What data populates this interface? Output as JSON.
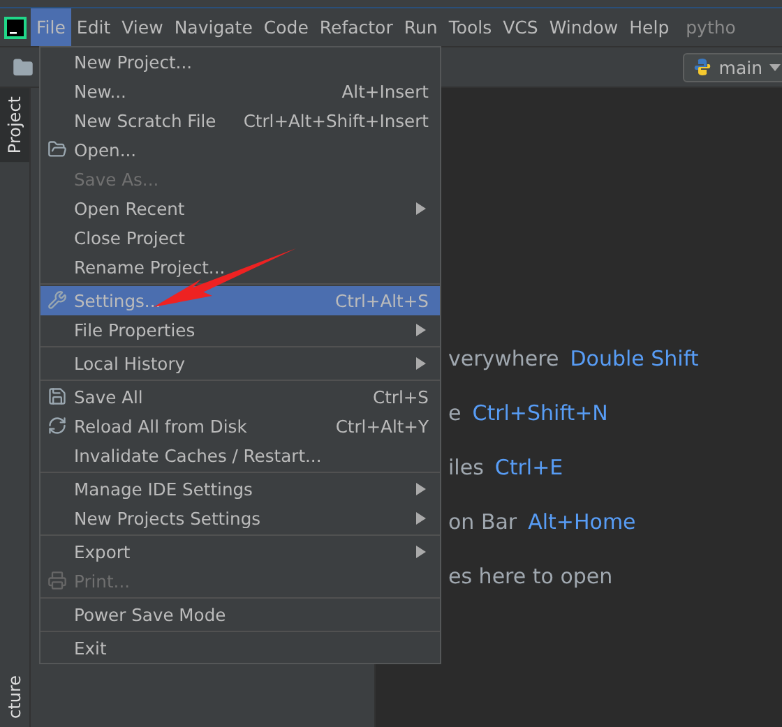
{
  "menu_bar": {
    "items": [
      {
        "label": "File",
        "selected": true
      },
      {
        "label": "Edit",
        "selected": false
      },
      {
        "label": "View",
        "selected": false
      },
      {
        "label": "Navigate",
        "selected": false
      },
      {
        "label": "Code",
        "selected": false
      },
      {
        "label": "Refactor",
        "selected": false
      },
      {
        "label": "Run",
        "selected": false
      },
      {
        "label": "Tools",
        "selected": false
      },
      {
        "label": "VCS",
        "selected": false
      },
      {
        "label": "Window",
        "selected": false
      },
      {
        "label": "Help",
        "selected": false
      }
    ],
    "project_title": "pytho"
  },
  "toolbar": {
    "run_config": "main"
  },
  "tool_strip": {
    "tabs": [
      {
        "label": "Project",
        "selected": true
      },
      {
        "label": "cture",
        "selected": false
      }
    ]
  },
  "editor_hints": [
    {
      "text": "verywhere",
      "shortcut": "Double Shift"
    },
    {
      "text": "e",
      "shortcut": "Ctrl+Shift+N"
    },
    {
      "text": "iles",
      "shortcut": "Ctrl+E"
    },
    {
      "text": "on Bar",
      "shortcut": "Alt+Home"
    },
    {
      "text": "es here to open"
    }
  ],
  "file_menu": {
    "groups": [
      [
        {
          "label": "New Project...",
          "disabled": false,
          "selected": false,
          "submenu": false
        },
        {
          "label": "New...",
          "shortcut": "Alt+Insert",
          "disabled": false,
          "selected": false,
          "submenu": false
        },
        {
          "label": "New Scratch File",
          "shortcut": "Ctrl+Alt+Shift+Insert",
          "disabled": false,
          "selected": false,
          "submenu": false
        },
        {
          "label": "Open...",
          "disabled": false,
          "selected": false,
          "submenu": false
        },
        {
          "label": "Save As...",
          "disabled": true,
          "selected": false,
          "submenu": false
        },
        {
          "label": "Open Recent",
          "disabled": false,
          "selected": false,
          "submenu": true
        },
        {
          "label": "Close Project",
          "disabled": false,
          "selected": false,
          "submenu": false
        },
        {
          "label": "Rename Project...",
          "disabled": false,
          "selected": false,
          "submenu": false
        }
      ],
      [
        {
          "label": "Settings...",
          "shortcut": "Ctrl+Alt+S",
          "disabled": false,
          "selected": true,
          "submenu": false
        },
        {
          "label": "File Properties",
          "disabled": false,
          "selected": false,
          "submenu": true
        }
      ],
      [
        {
          "label": "Local History",
          "disabled": false,
          "selected": false,
          "submenu": true
        }
      ],
      [
        {
          "label": "Save All",
          "shortcut": "Ctrl+S",
          "disabled": false,
          "selected": false,
          "submenu": false
        },
        {
          "label": "Reload All from Disk",
          "shortcut": "Ctrl+Alt+Y",
          "disabled": false,
          "selected": false,
          "submenu": false
        },
        {
          "label": "Invalidate Caches / Restart...",
          "disabled": false,
          "selected": false,
          "submenu": false
        }
      ],
      [
        {
          "label": "Manage IDE Settings",
          "disabled": false,
          "selected": false,
          "submenu": true
        },
        {
          "label": "New Projects Settings",
          "disabled": false,
          "selected": false,
          "submenu": true
        }
      ],
      [
        {
          "label": "Export",
          "disabled": false,
          "selected": false,
          "submenu": true
        },
        {
          "label": "Print...",
          "disabled": true,
          "selected": false,
          "submenu": false
        }
      ],
      [
        {
          "label": "Power Save Mode",
          "disabled": false,
          "selected": false,
          "submenu": false
        }
      ],
      [
        {
          "label": "Exit",
          "disabled": false,
          "selected": false,
          "submenu": false
        }
      ]
    ]
  }
}
